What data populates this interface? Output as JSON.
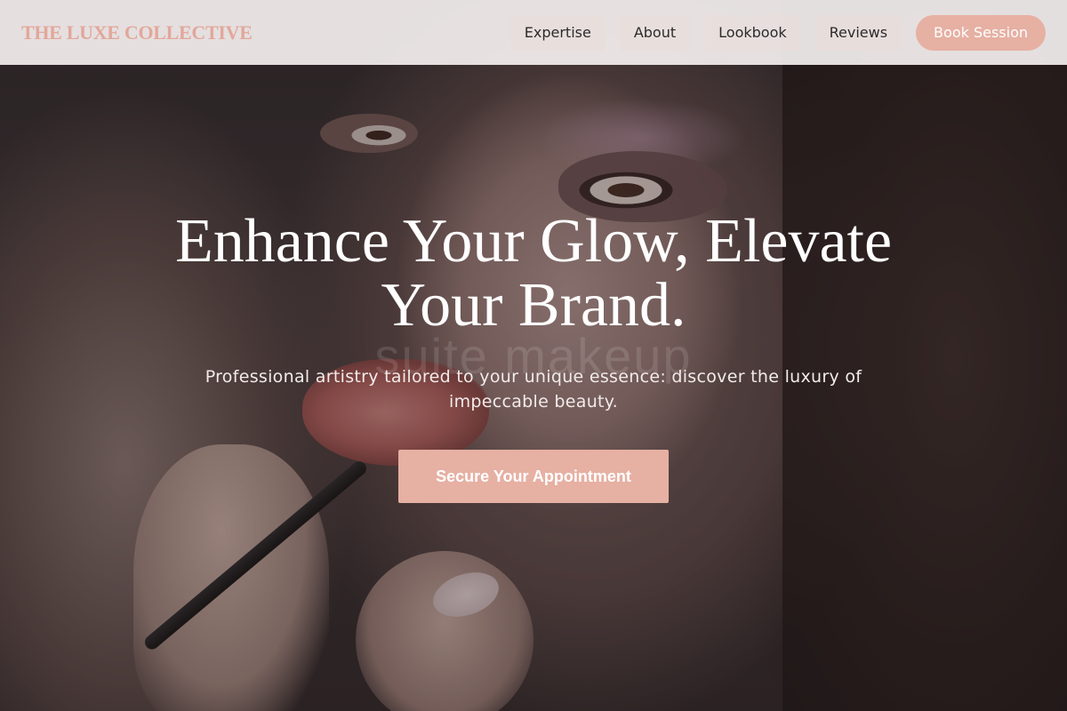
{
  "header": {
    "brand": "THE LUXE COLLECTIVE",
    "nav": [
      {
        "label": "Expertise"
      },
      {
        "label": "About"
      },
      {
        "label": "Lookbook"
      },
      {
        "label": "Reviews"
      }
    ],
    "cta_label": "Book Session"
  },
  "hero": {
    "headline": "Enhance Your Glow, Elevate Your Brand.",
    "subline": "Professional artistry tailored to your unique essence: discover the luxury of impeccable beauty.",
    "cta_label": "Secure Your Appointment",
    "watermark": "suite makeup"
  },
  "colors": {
    "accent": "#e6b0a3",
    "brand_text": "#e2a79a",
    "header_bg": "#f5f0f0"
  }
}
